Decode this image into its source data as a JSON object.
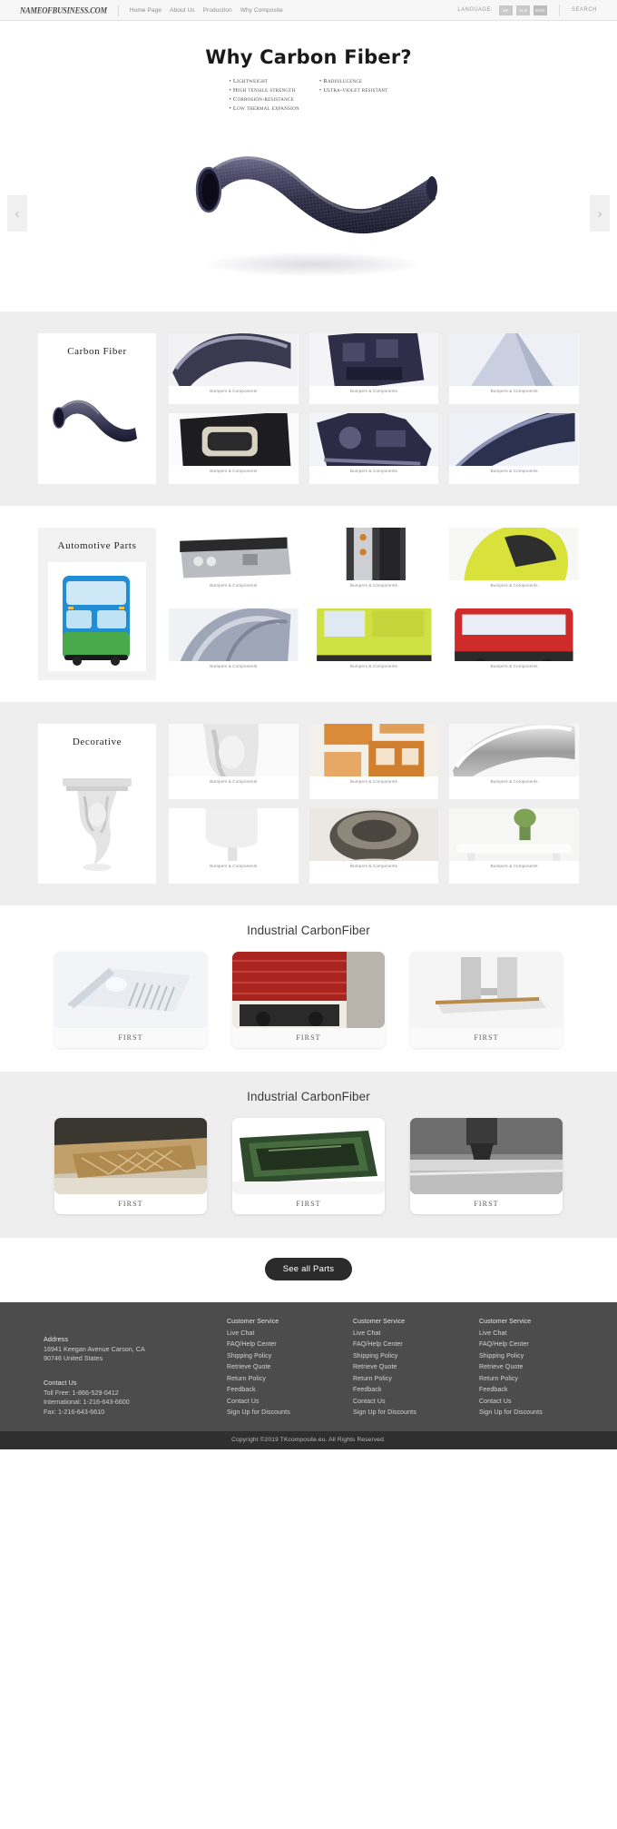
{
  "header": {
    "brand": "NAMEOFBUSINESS.COM",
    "nav": [
      {
        "label": "Home Page"
      },
      {
        "label": "About Us"
      },
      {
        "label": "Production"
      },
      {
        "label": "Why Composite"
      }
    ],
    "language_label": "LANGUAGE:",
    "languages": [
      {
        "code": "MK"
      },
      {
        "code": "ALB"
      },
      {
        "code": "ENG"
      }
    ],
    "search_label": "SEARCH"
  },
  "hero": {
    "title": "Why Carbon Fiber?",
    "bullets_left": [
      "Lightweight",
      "High tensile strength",
      "Corrosion-resistance",
      "Low thermal expansion"
    ],
    "bullets_right": [
      "Radiolucence",
      "Ultra-violet resistant"
    ],
    "prev_arrow": "‹",
    "next_arrow": "›"
  },
  "categories": [
    {
      "title": "Carbon Fiber",
      "thumbs": [
        {
          "caption": "Bumpers &\nComponents"
        },
        {
          "caption": "Bumpers &\nComponents"
        },
        {
          "caption": "Bumpers &\nComponents"
        },
        {
          "caption": "Bumpers &\nComponents"
        },
        {
          "caption": "Bumpers &\nComponents"
        },
        {
          "caption": "Bumpers &\nComponents"
        }
      ]
    },
    {
      "title": "Automotive Parts",
      "thumbs": [
        {
          "caption": "Bumpers &\nComponents"
        },
        {
          "caption": "Bumpers &\nComponents"
        },
        {
          "caption": "Bumpers &\nComponents"
        },
        {
          "caption": "Bumpers &\nComponents"
        },
        {
          "caption": "Bumpers &\nComponents"
        },
        {
          "caption": "Bumpers &\nComponents"
        }
      ]
    },
    {
      "title": "Decorative",
      "thumbs": [
        {
          "caption": "Bumpers &\nComponents"
        },
        {
          "caption": "Bumpers &\nComponents"
        },
        {
          "caption": "Bumpers &\nComponents"
        },
        {
          "caption": "Bumpers &\nComponents"
        },
        {
          "caption": "Bumpers &\nComponents"
        },
        {
          "caption": "Bumpers &\nComponents"
        }
      ]
    }
  ],
  "industrial_1": {
    "title": "Industrial CarbonFiber",
    "cards": [
      {
        "caption": "FIRST"
      },
      {
        "caption": "FIRST"
      },
      {
        "caption": "FIRST"
      }
    ]
  },
  "industrial_2": {
    "title": "Industrial CarbonFiber",
    "cards": [
      {
        "caption": "FIRST"
      },
      {
        "caption": "FIRST"
      },
      {
        "caption": "FIRST"
      }
    ]
  },
  "cta": {
    "label": "See all Parts"
  },
  "footer": {
    "address_head": "Address",
    "address_line1": "16941 Keegan Avenue Carson, CA",
    "address_line2": "90746 United States",
    "contact_head": "Contact Us",
    "contact_line1": "Toll Free: 1-866-529-0412",
    "contact_line2": "International: 1-216-643-6600",
    "contact_line3": "Fax: 1-216-643-6610",
    "columns": [
      {
        "links": [
          "Customer Service",
          "Live Chat",
          "FAQ/Help Center",
          "Shipping Policy",
          "Retrieve Quote",
          "Return Policy",
          "Feedback",
          "Contact Us",
          "Sign Up for Discounts"
        ]
      },
      {
        "links": [
          "Customer Service",
          "Live Chat",
          "FAQ/Help Center",
          "Shipping Policy",
          "Retrieve Quote",
          "Return Policy",
          "Feedback",
          "Contact Us",
          "Sign Up for Discounts"
        ]
      },
      {
        "links": [
          "Customer Service",
          "Live Chat",
          "FAQ/Help Center",
          "Shipping Policy",
          "Retrieve Quote",
          "Return Policy",
          "Feedback",
          "Contact Us",
          "Sign Up for Discounts"
        ]
      }
    ]
  },
  "copyright": "Copyright ©2019 TKcomposite.eu. All Rights Reserved.",
  "colors": {
    "header_bg": "#f7f7f7",
    "section_grey": "#eeeeee",
    "footer_bg": "#4c4c4c",
    "copyright_bg": "#2f2f2f",
    "cta_bg": "#2b2b2b"
  }
}
